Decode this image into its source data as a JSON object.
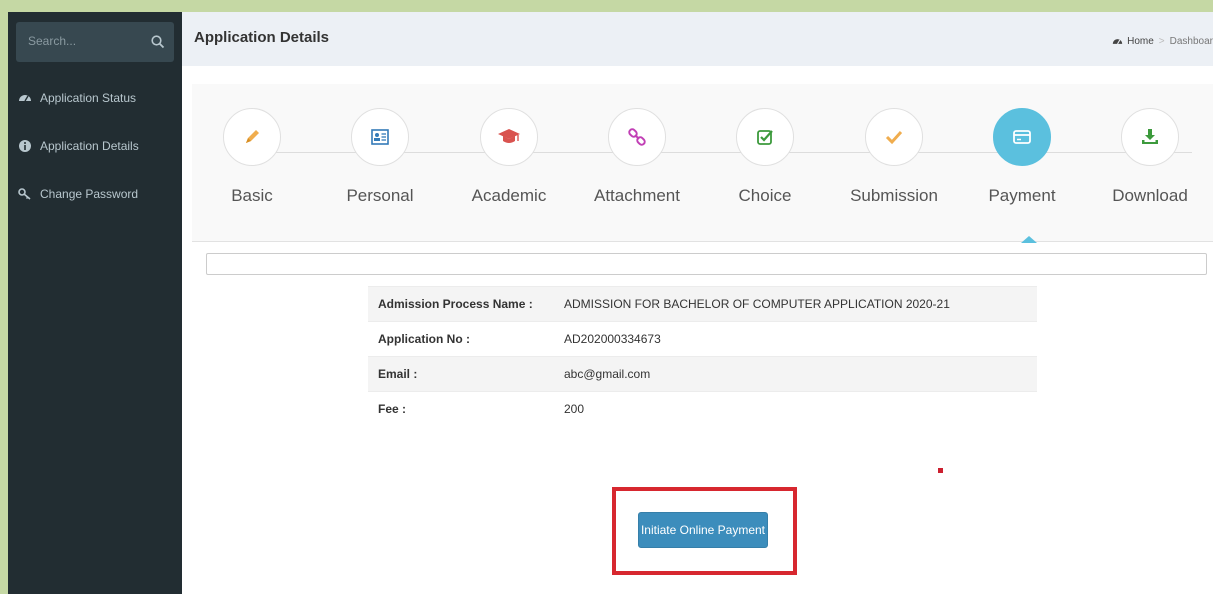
{
  "sidebar": {
    "search_placeholder": "Search...",
    "items": [
      {
        "label": "Application Status",
        "icon": "dashboard-icon"
      },
      {
        "label": "Application Details",
        "icon": "info-circle-icon"
      },
      {
        "label": "Change Password",
        "icon": "key-icon"
      }
    ]
  },
  "header": {
    "title": "Application Details",
    "breadcrumb": {
      "home": "Home",
      "current": "Dashboar"
    }
  },
  "wizard": {
    "steps": [
      {
        "label": "Basic",
        "icon": "pencil-icon",
        "color": "#f0ad4e"
      },
      {
        "label": "Personal",
        "icon": "id-card-icon",
        "color": "#337ab7"
      },
      {
        "label": "Academic",
        "icon": "graduation-cap-icon",
        "color": "#d9534f"
      },
      {
        "label": "Attachment",
        "icon": "link-icon",
        "color": "#c13fb5"
      },
      {
        "label": "Choice",
        "icon": "check-square-icon",
        "color": "#3c9a3c"
      },
      {
        "label": "Submission",
        "icon": "checkmark-icon",
        "color": "#f0ad4e"
      },
      {
        "label": "Payment",
        "icon": "credit-card-icon",
        "color": "#ffffff",
        "active": true
      },
      {
        "label": "Download",
        "icon": "download-icon",
        "color": "#3c9a3c"
      }
    ]
  },
  "details": {
    "rows": [
      {
        "label": "Admission Process Name :",
        "value": "ADMISSION FOR BACHELOR OF COMPUTER APPLICATION 2020-21"
      },
      {
        "label": "Application No :",
        "value": "AD202000334673"
      },
      {
        "label": "Email :",
        "value": "abc@gmail.com"
      },
      {
        "label": "Fee :",
        "value": "200"
      }
    ]
  },
  "payment": {
    "button_label": "Initiate Online Payment"
  },
  "colors": {
    "accent": "#5bc0de",
    "primary_button": "#3c8dbc",
    "highlight": "#d7272f",
    "sidebar": "#222d32"
  }
}
